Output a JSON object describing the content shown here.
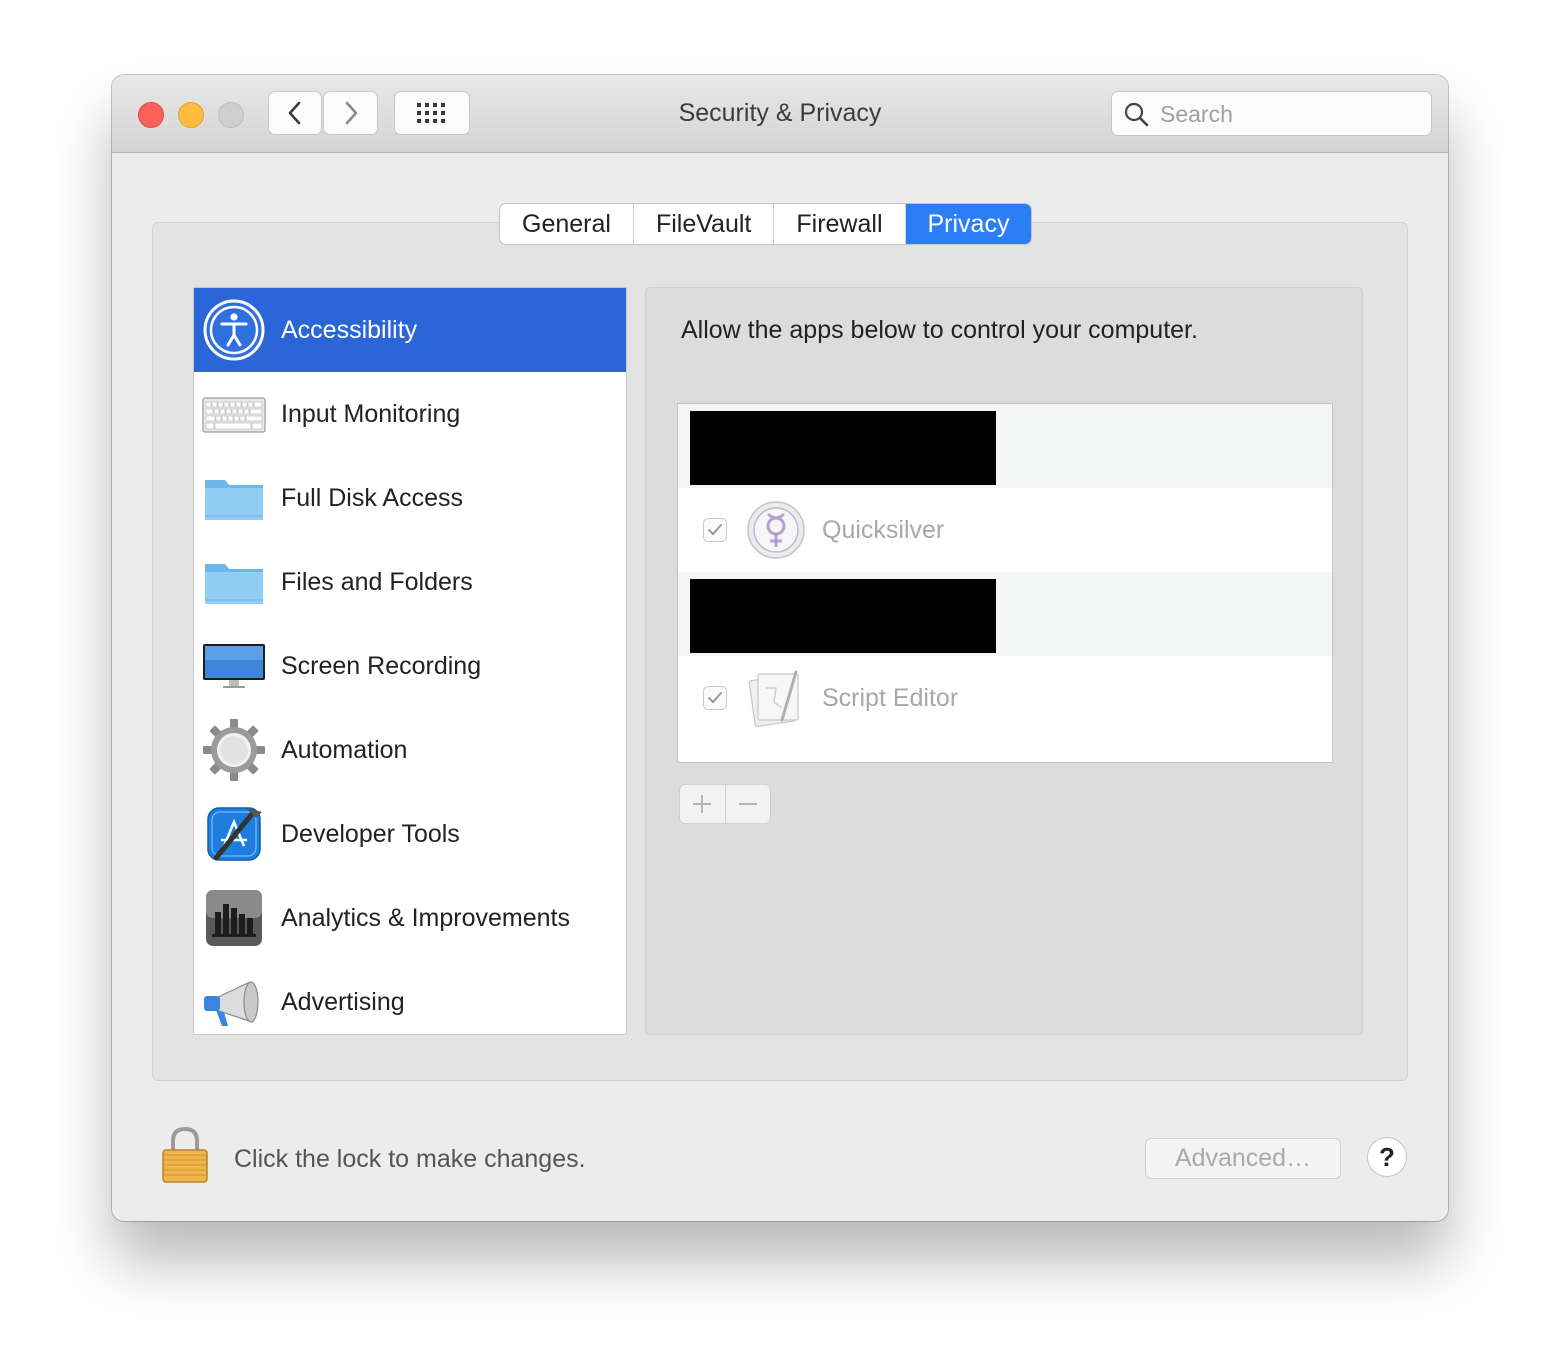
{
  "window": {
    "title": "Security & Privacy"
  },
  "toolbar": {
    "back_icon": "chevron-left-icon",
    "forward_icon": "chevron-right-icon",
    "grid_icon": "grid-icon"
  },
  "search": {
    "placeholder": "Search",
    "icon": "search-icon"
  },
  "tabs": [
    {
      "label": "General",
      "active": false
    },
    {
      "label": "FileVault",
      "active": false
    },
    {
      "label": "Firewall",
      "active": false
    },
    {
      "label": "Privacy",
      "active": true
    }
  ],
  "categories": [
    {
      "label": "Accessibility",
      "icon": "accessibility-icon",
      "selected": true
    },
    {
      "label": "Input Monitoring",
      "icon": "keyboard-icon"
    },
    {
      "label": "Full Disk Access",
      "icon": "folder-icon"
    },
    {
      "label": "Files and Folders",
      "icon": "folder-icon"
    },
    {
      "label": "Screen Recording",
      "icon": "monitor-icon"
    },
    {
      "label": "Automation",
      "icon": "gear-icon"
    },
    {
      "label": "Developer Tools",
      "icon": "xcode-icon"
    },
    {
      "label": "Analytics & Improvements",
      "icon": "bar-chart-icon"
    },
    {
      "label": "Advertising",
      "icon": "megaphone-icon"
    }
  ],
  "panel": {
    "description": "Allow the apps below to control your computer.",
    "apps": [
      {
        "name": "",
        "redacted": true
      },
      {
        "name": "Quicksilver",
        "checked": true,
        "icon": "quicksilver-icon"
      },
      {
        "name": "",
        "redacted": true
      },
      {
        "name": "Script Editor",
        "checked": true,
        "icon": "script-editor-icon"
      }
    ],
    "add_icon": "plus-icon",
    "remove_icon": "minus-icon"
  },
  "footer": {
    "lock_icon": "lock-icon",
    "lock_text": "Click the lock to make changes.",
    "advanced_label": "Advanced…",
    "help_label": "?"
  },
  "colors": {
    "accent": "#2c7ef6",
    "selection": "#2b66d9",
    "close": "#fc605b",
    "minimize": "#fdbc40"
  }
}
